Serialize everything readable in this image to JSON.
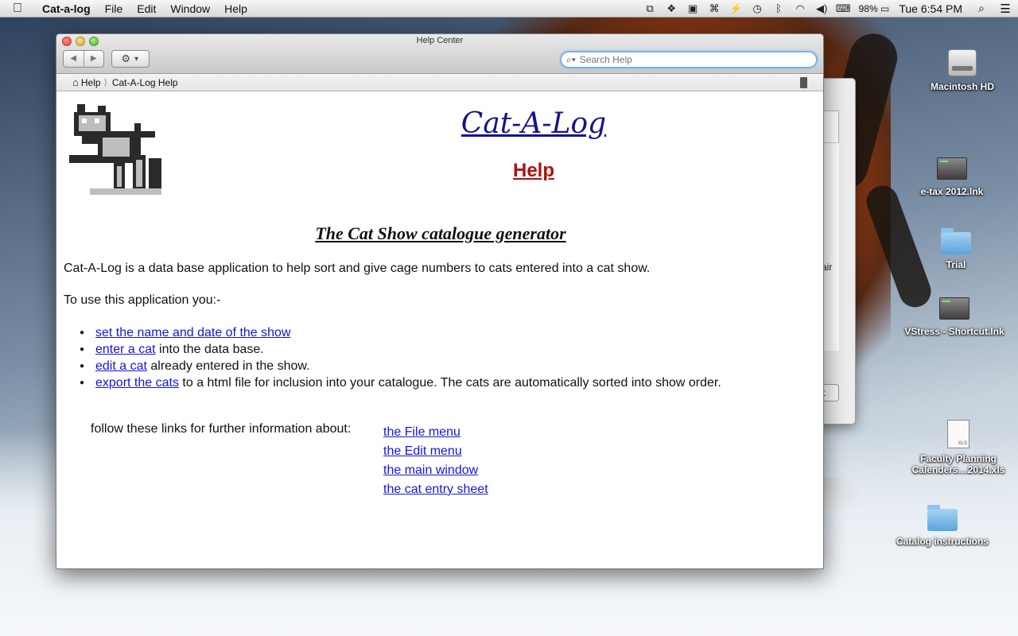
{
  "menubar": {
    "apple_icon": "",
    "app_name": "Cat-a-log",
    "items": [
      "File",
      "Edit",
      "Window",
      "Help"
    ],
    "tray_icons": [
      "screen-share-icon",
      "dropbox-icon",
      "box-icon",
      "command-icon",
      "flashlight-icon",
      "time-machine-icon",
      "bluetooth-icon",
      "wifi-icon",
      "volume-icon",
      "keyboard-icon"
    ],
    "battery": "98%",
    "clock": "Tue 6:54 PM",
    "search_icon": "magnifier",
    "list_icon": "list"
  },
  "help_window": {
    "title": "Help Center",
    "search_placeholder": "Search Help",
    "breadcrumb": {
      "home": "Help",
      "current": "Cat-A-Log Help"
    }
  },
  "page": {
    "app_title": "Cat-A-Log",
    "help_title": "Help",
    "tagline": "The Cat Show catalogue generator",
    "intro": "Cat-A-Log is a data base application to help sort and give cage numbers to cats entered into a cat show.",
    "use_line": "To use this application you:-",
    "bullets": [
      {
        "link": "set the name and date of the show",
        "rest": ""
      },
      {
        "link": "enter a cat",
        "rest": " into the data base."
      },
      {
        "link": "edit a cat",
        "rest": " already entered in the show."
      },
      {
        "link": "export the cats",
        "rest": " to a html file for inclusion into your catalogue. The cats are automatically sorted into show order."
      }
    ],
    "follow_text": "follow these links for further information about:",
    "more_links": [
      "the File menu",
      "the Edit menu",
      "the main window",
      "the cat entry sheet"
    ]
  },
  "background_window": {
    "fragment_text": "air",
    "button_fragment": "t"
  },
  "desktop_icons": [
    {
      "label": "Macintosh HD",
      "icon": "hard-drive-icon"
    },
    {
      "label": "e-tax 2012.lnk",
      "icon": "shortcut-icon"
    },
    {
      "label": "Trial",
      "icon": "folder-icon"
    },
    {
      "label": "VStress - Shortcut.lnk",
      "icon": "shortcut-icon"
    },
    {
      "label": "Faculty Planning Calenders…2014.xls",
      "icon": "xls-file-icon"
    },
    {
      "label": "Catalog instructions",
      "icon": "folder-icon"
    }
  ]
}
